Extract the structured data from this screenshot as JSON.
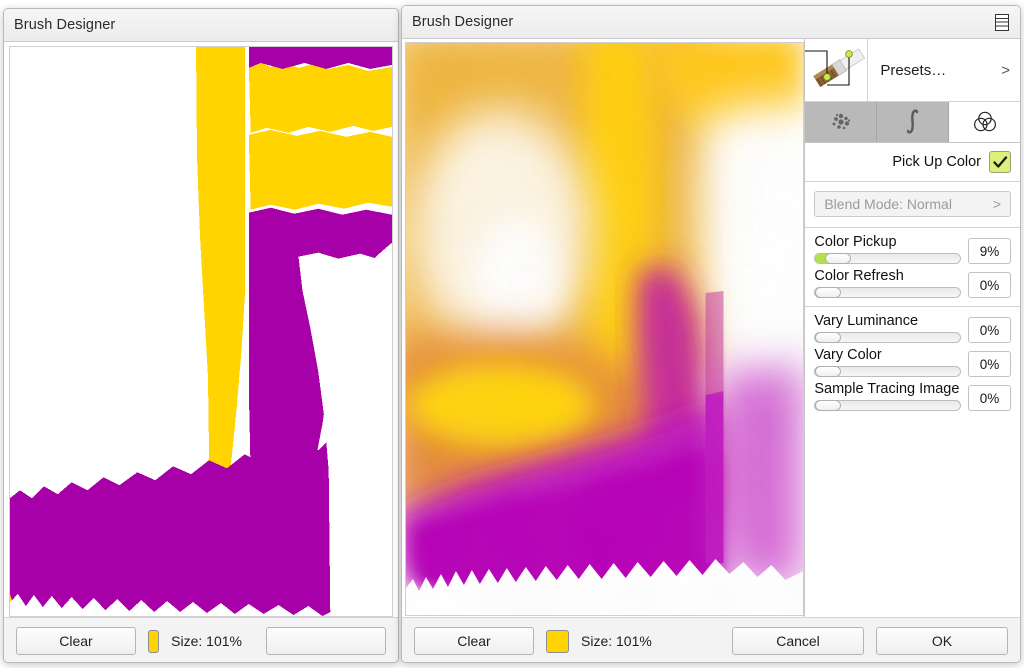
{
  "left_window": {
    "title": "Brush Designer",
    "footer": {
      "clear_label": "Clear",
      "color_swatch": "#FFD400",
      "size_label": "Size: 101%"
    }
  },
  "right_window": {
    "title": "Brush Designer",
    "menu_icon": "list-menu-icon",
    "panel": {
      "preset": {
        "label": "Presets…",
        "chevron": ">",
        "thumb_icon": "brush-preview-thumbnail"
      },
      "tabs": [
        {
          "name": "spray-dots-tab",
          "icon": "spray-dots-icon",
          "active": false
        },
        {
          "name": "curve-tab",
          "icon": "s-curve-icon",
          "active": false
        },
        {
          "name": "color-tab",
          "icon": "venn-circles-icon",
          "active": true
        }
      ],
      "pick_up_color": {
        "label": "Pick Up Color",
        "checked": true,
        "check_color": "#dff07a"
      },
      "blend_mode": {
        "label": "Blend Mode: Normal",
        "chevron": ">",
        "disabled": true
      },
      "slider_groups": [
        {
          "sliders": [
            {
              "label": "Color Pickup",
              "value": "9%",
              "pct": 9,
              "filled": true
            },
            {
              "label": "Color Refresh",
              "value": "0%",
              "pct": 0,
              "filled": false
            }
          ]
        },
        {
          "sliders": [
            {
              "label": "Vary Luminance",
              "value": "0%",
              "pct": 0,
              "filled": false
            },
            {
              "label": "Vary Color",
              "value": "0%",
              "pct": 0,
              "filled": false
            },
            {
              "label": "Sample Tracing Image",
              "value": "0%",
              "pct": 0,
              "filled": false
            }
          ]
        }
      ]
    },
    "footer": {
      "clear_label": "Clear",
      "color_swatch": "#FFD400",
      "size_label": "Size: 101%",
      "cancel_label": "Cancel",
      "ok_label": "OK"
    }
  },
  "palette": {
    "yellow": "#FFD400",
    "magenta": "#A800A8",
    "accent_green": "#b2e248",
    "window_chrome": "#f3f3f3"
  }
}
